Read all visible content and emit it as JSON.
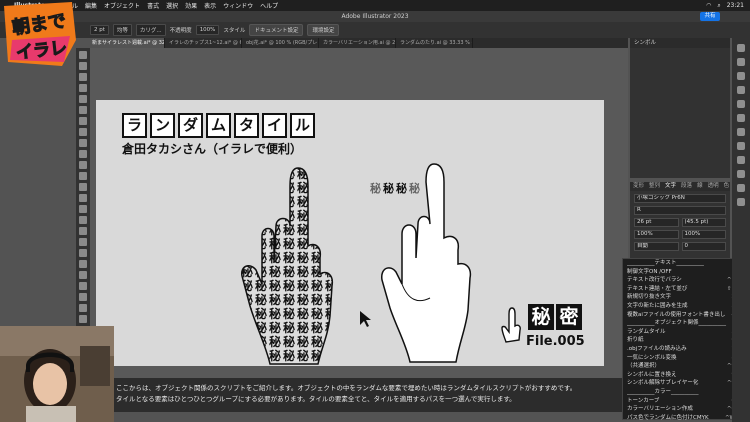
{
  "menubar": {
    "app": "Illustrator",
    "items": [
      "ファイル",
      "編集",
      "オブジェクト",
      "書式",
      "選択",
      "効果",
      "表示",
      "ウィンドウ",
      "ヘルプ"
    ],
    "clock": "23:21"
  },
  "window": {
    "title": "Adobe Illustrator 2023",
    "share_label": "共有"
  },
  "controlbar": {
    "stroke_weight": "2 pt",
    "brush_label": "均等",
    "brush_type": "カリグ...",
    "opacity_label": "不透明度",
    "opacity_value": "100%",
    "style_label": "スタイル",
    "doc_setup": "ドキュメント設定",
    "prefs": "環境設定"
  },
  "tabs": [
    "新まサイラレスト週載.ai* @ 32.86 % (RGB/プレビュー)",
    "イラレのチップス1~12.ai* @ 62.34 %",
    "obj花.ai* @ 100 % (RGB/プレビュー)",
    "カラーバリエーション用.ai @ 25 %",
    "ランダムのたり.ai @ 33.33 % (CMYK/プ..."
  ],
  "artboard": {
    "title_chars": [
      "ラ",
      "ン",
      "ダ",
      "ム",
      "タ",
      "イ",
      "ル"
    ],
    "subtitle": "倉田タカシさん（イラレで便利）",
    "word_tiles": [
      "秘",
      "秘",
      "秘",
      "秘"
    ],
    "file_chars": [
      "秘",
      "密"
    ],
    "file_label": "File.005"
  },
  "subtitles": {
    "line1": "ここからは、オブジェクト関係のスクリプトをご紹介します。オブジェクトの中をランダムな要素で埋めたい時はランダムタイルスクリプトがおすすめです。",
    "line2": "タイルとなる要素はひとつひとつグループにする必要があります。タイルの要素全てと、タイルを適用するパスを一つ選んで実行します。"
  },
  "symbols_panel": {
    "tab": "シンボル"
  },
  "character_panel": {
    "tabs": [
      "変形",
      "整列",
      "文字",
      "段落",
      "線",
      "透明",
      "色"
    ],
    "font": "小塚ゴシック Pr6N",
    "weight": "R",
    "size": "26 pt",
    "leading": "(45.5 pt)",
    "scale_v": "100%",
    "scale_h": "100%",
    "tracking": "自動",
    "kerning": "0"
  },
  "script_menu": {
    "items": [
      {
        "label": "__________テキスト__________",
        "key": ""
      },
      {
        "label": "制御文字ON /OFF",
        "key": "1"
      },
      {
        "label": "テキスト改行でバラシ",
        "key": "^1"
      },
      {
        "label": "テキスト連結・左て並び",
        "key": "⇧1"
      },
      {
        "label": "新規切り抜き文字",
        "key": "2"
      },
      {
        "label": "文字の新たに囲みを生成",
        "key": "3"
      },
      {
        "label": "複数aiファイルの使用フォント書き出し",
        "key": "4"
      },
      {
        "label": "__________オブジェクト関係__________",
        "key": ""
      },
      {
        "label": "ランダムタイル",
        "key": "5"
      },
      {
        "label": "折り紙",
        "key": "6"
      },
      {
        "label": ".objファイルの読み込み",
        "key": "7"
      },
      {
        "label": "一気にシンボル変換",
        "key": "8"
      },
      {
        "label": "（共通選択）",
        "key": "^9"
      },
      {
        "label": "シンボルに置き換え",
        "key": "9"
      },
      {
        "label": "シンボル解除サブレイヤー化",
        "key": "^9"
      },
      {
        "label": "__________カラー__________",
        "key": ""
      },
      {
        "label": "トーンカーブ",
        "key": "0"
      },
      {
        "label": "カラーバリエーション作成",
        "key": "^0"
      },
      {
        "label": "パス色でランダムに色付けCMYK",
        "key": "^W"
      }
    ]
  },
  "logo": {
    "text1": "朝まで",
    "text2": "イラレ"
  },
  "colors": {
    "accent": "#1473e6",
    "logo_orange": "#f07a1a",
    "logo_pink": "#e83a6c"
  }
}
